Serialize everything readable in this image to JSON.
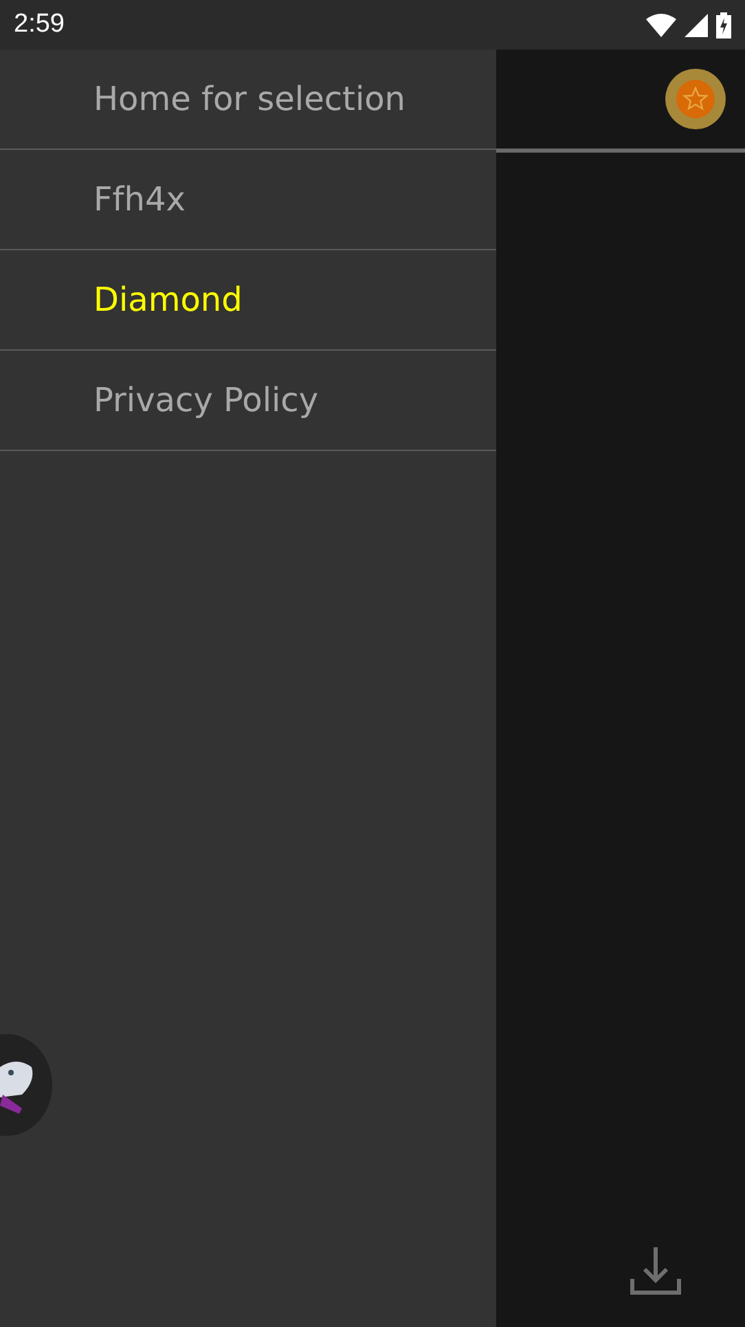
{
  "status_bar": {
    "time": "2:59"
  },
  "drawer": {
    "items": [
      {
        "label": "Home for selection",
        "selected": false
      },
      {
        "label": "Ffh4x",
        "selected": false
      },
      {
        "label": "Diamond",
        "selected": true
      },
      {
        "label": "Privacy Policy",
        "selected": false
      }
    ]
  }
}
